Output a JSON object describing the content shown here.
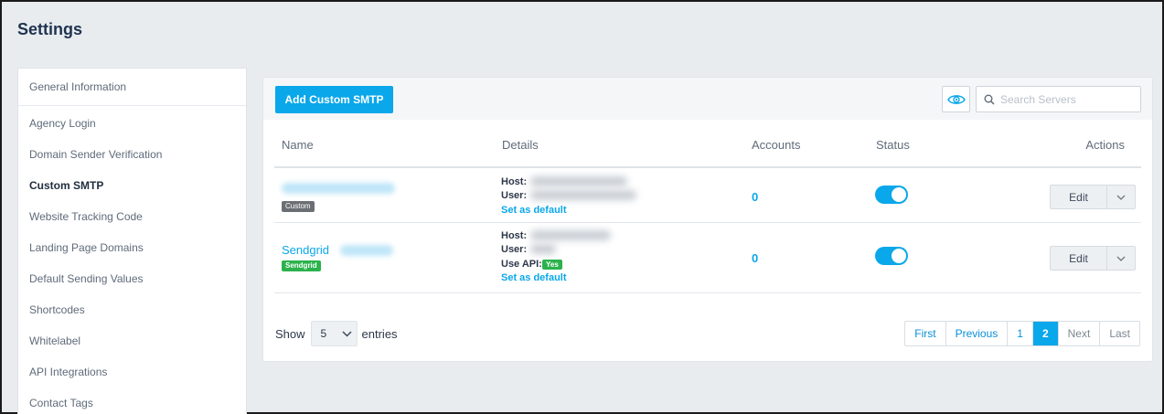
{
  "page": {
    "title": "Settings"
  },
  "sidebar": {
    "items": [
      {
        "label": "General Information"
      },
      {
        "label": "Agency Login"
      },
      {
        "label": "Domain Sender Verification"
      },
      {
        "label": "Custom SMTP"
      },
      {
        "label": "Website Tracking Code"
      },
      {
        "label": "Landing Page Domains"
      },
      {
        "label": "Default Sending Values"
      },
      {
        "label": "Shortcodes"
      },
      {
        "label": "Whitelabel"
      },
      {
        "label": "API Integrations"
      },
      {
        "label": "Contact Tags"
      }
    ],
    "active_index": 3
  },
  "toolbar": {
    "add_label": "Add Custom SMTP",
    "search_placeholder": "Search Servers"
  },
  "table": {
    "headers": {
      "name": "Name",
      "details": "Details",
      "accounts": "Accounts",
      "status": "Status",
      "actions": "Actions"
    },
    "rows": [
      {
        "name": "",
        "badge": "Custom",
        "host_label": "Host:",
        "user_label": "User:",
        "set_default": "Set as default",
        "accounts": "0",
        "status_on": true,
        "edit_label": "Edit"
      },
      {
        "name": "Sendgrid",
        "badge": "Sendgrid",
        "host_label": "Host:",
        "user_label": "User:",
        "api_label": "Use API:",
        "api_value": "Yes",
        "set_default": "Set as default",
        "accounts": "0",
        "status_on": true,
        "edit_label": "Edit"
      }
    ]
  },
  "footer": {
    "show_label": "Show",
    "entries_value": "5",
    "entries_label": "entries",
    "pagination": [
      "First",
      "Previous",
      "1",
      "2",
      "Next",
      "Last"
    ],
    "current_page": "2"
  },
  "colors": {
    "accent": "#0aa7ea",
    "success": "#2bb24c",
    "custom_badge": "#6b6f73"
  }
}
